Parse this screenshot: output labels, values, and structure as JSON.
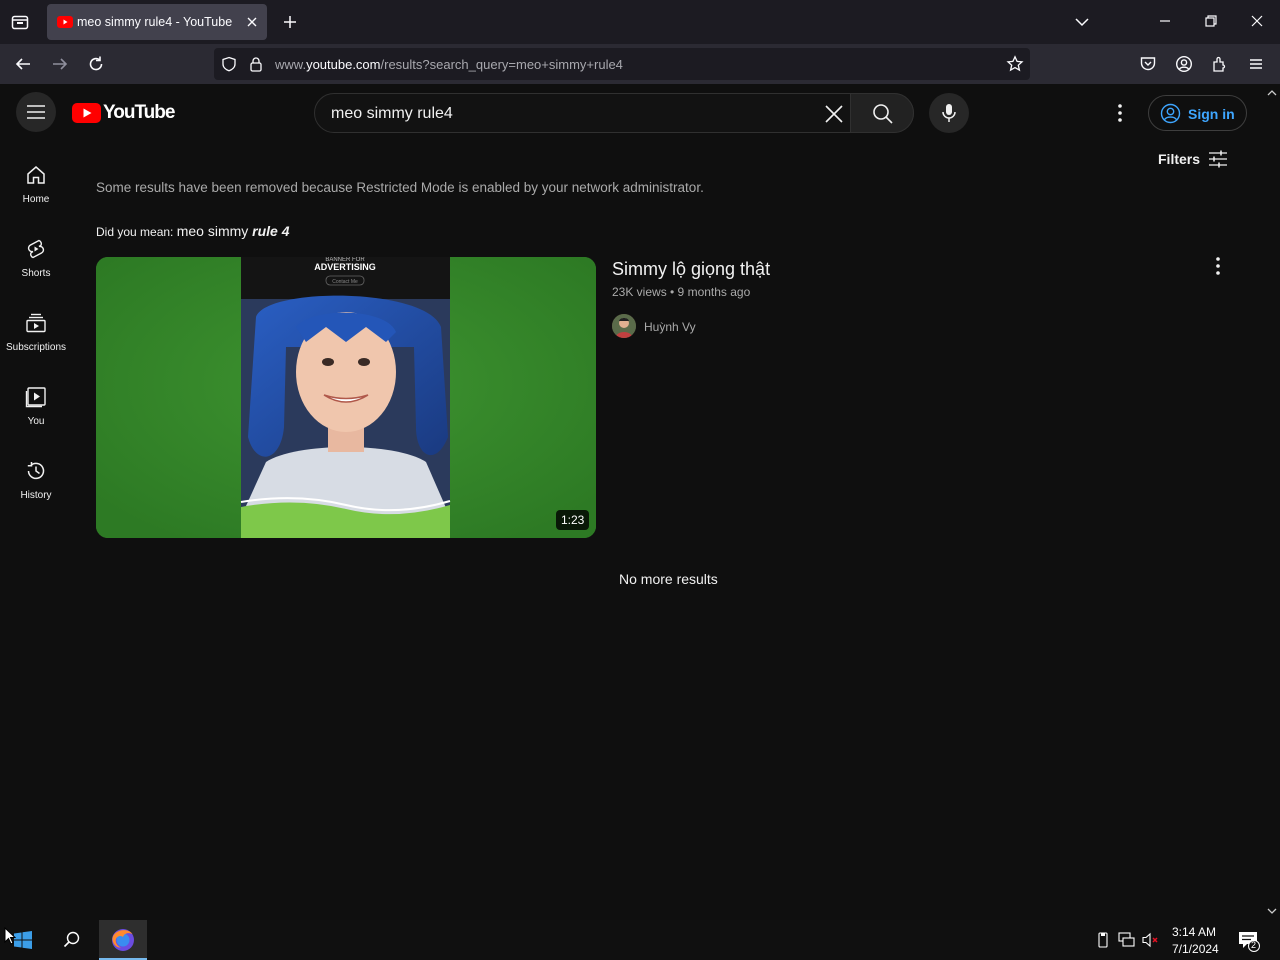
{
  "browser": {
    "tab_title": "meo simmy rule4 - YouTube",
    "url_prefix": "www.",
    "url_host": "youtube.com",
    "url_path": "/results?search_query=meo+simmy+rule4"
  },
  "youtube": {
    "logo_text": "YouTube",
    "search_query": "meo simmy rule4",
    "sign_in_label": "Sign in",
    "filters_label": "Filters"
  },
  "sidebar": {
    "items": [
      {
        "label": "Home",
        "icon": "home-icon"
      },
      {
        "label": "Shorts",
        "icon": "shorts-icon"
      },
      {
        "label": "Subscriptions",
        "icon": "subscriptions-icon"
      },
      {
        "label": "You",
        "icon": "you-icon"
      },
      {
        "label": "History",
        "icon": "history-icon"
      }
    ]
  },
  "results": {
    "restricted_notice": "Some results have been removed because Restricted Mode is enabled by your network administrator.",
    "did_you_mean_label": "Did you mean:",
    "suggestion_plain": "meo simmy",
    "suggestion_emphasis": "rule 4",
    "video": {
      "title": "Simmy lộ giọng thật",
      "meta": "23K views • 9 months ago",
      "channel": "Huỳnh Vy",
      "duration": "1:23",
      "thumb_banner_small": "BANNER FOR",
      "thumb_banner_large": "ADVERTISING",
      "thumb_banner_button": "Contact Me"
    },
    "end_text": "No more results"
  },
  "taskbar": {
    "time": "3:14 AM",
    "date": "7/1/2024",
    "notification_count": "2"
  },
  "colors": {
    "yt_red": "#ff0000",
    "link_blue": "#3ea6ff",
    "thumb_green": "#3a8a2c"
  }
}
